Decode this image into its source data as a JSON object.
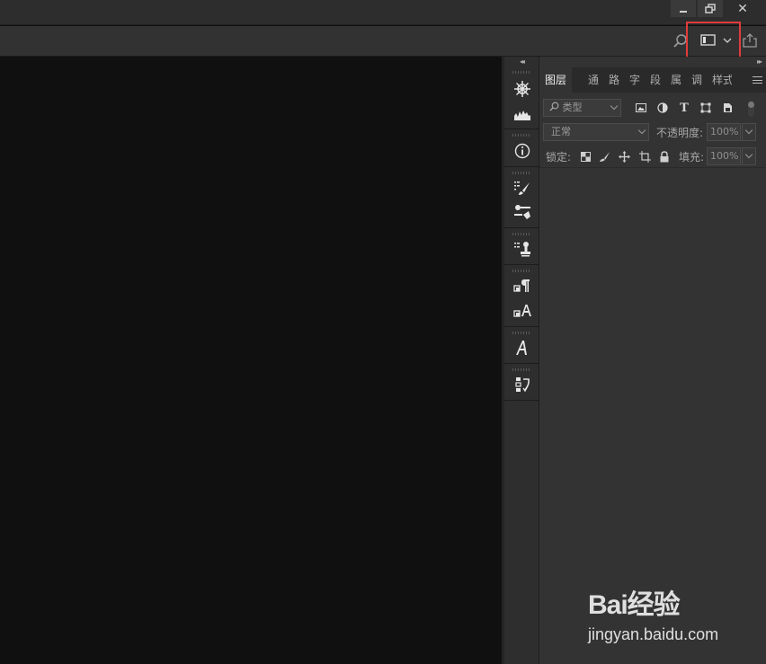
{
  "window": {
    "close_glyph": "✕"
  },
  "header": {
    "icons": [
      "search-icon",
      "workspace-panel-icon",
      "share-icon"
    ],
    "highlight_color": "#e23b3b"
  },
  "layers_panel": {
    "tabs": [
      "图层",
      "通",
      "路",
      "字",
      "段",
      "属",
      "调",
      "样式"
    ],
    "filter_kind": {
      "label": "类型"
    },
    "filter_icons": [
      "image-filter-icon",
      "adjustment-filter-icon",
      "type-filter-icon",
      "shape-filter-icon",
      "smart-object-filter-icon"
    ],
    "blend_mode": "正常",
    "opacity": {
      "label": "不透明度:",
      "value": "100%"
    },
    "lock": {
      "label": "锁定:",
      "icons": [
        "lock-transparent-icon",
        "lock-paint-icon",
        "lock-move-icon",
        "lock-artboard-icon",
        "lock-all-icon"
      ]
    },
    "fill": {
      "label": "填充:",
      "value": "100%"
    }
  },
  "iconbar": {
    "tools": [
      "navigator-icon",
      "histogram-icon",
      "info-icon",
      "brush-settings-icon",
      "tool-presets-icon",
      "clone-source-icon",
      "paragraph-styles-icon",
      "character-styles-icon",
      "glyphs-icon",
      "history-icon"
    ]
  },
  "watermark": {
    "brand": "Bai经验",
    "url": "jingyan.baidu.com"
  },
  "colors": {
    "canvas": "#101010",
    "panel": "#333333",
    "toolbar": "#323232"
  }
}
